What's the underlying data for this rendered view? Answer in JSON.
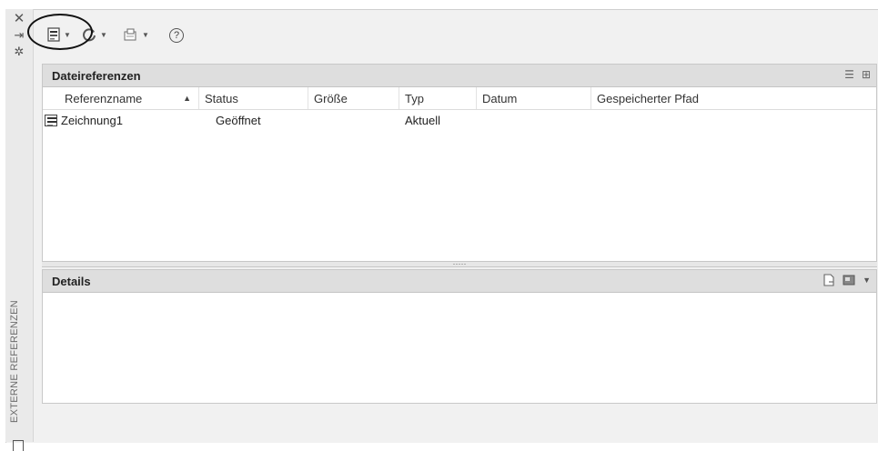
{
  "sidebar": {
    "title": "EXTERNE REFERENZEN",
    "icons": [
      "close-icon",
      "auto-hide-icon",
      "properties-icon"
    ]
  },
  "toolbar": {
    "attach_caret": "▼",
    "refresh_caret": "▼",
    "change_path_caret": "▼",
    "help": "?"
  },
  "file_references": {
    "title": "Dateireferenzen",
    "columns": [
      "Referenzname",
      "Status",
      "Größe",
      "Typ",
      "Datum",
      "Gespeicherter Pfad"
    ],
    "sort_indicator": "▲",
    "rows": [
      {
        "name": "Zeichnung1",
        "status": "Geöffnet",
        "size": "",
        "type": "Aktuell",
        "date": "",
        "path": ""
      }
    ]
  },
  "splitter": {
    "grip": "·····"
  },
  "details": {
    "title": "Details"
  }
}
